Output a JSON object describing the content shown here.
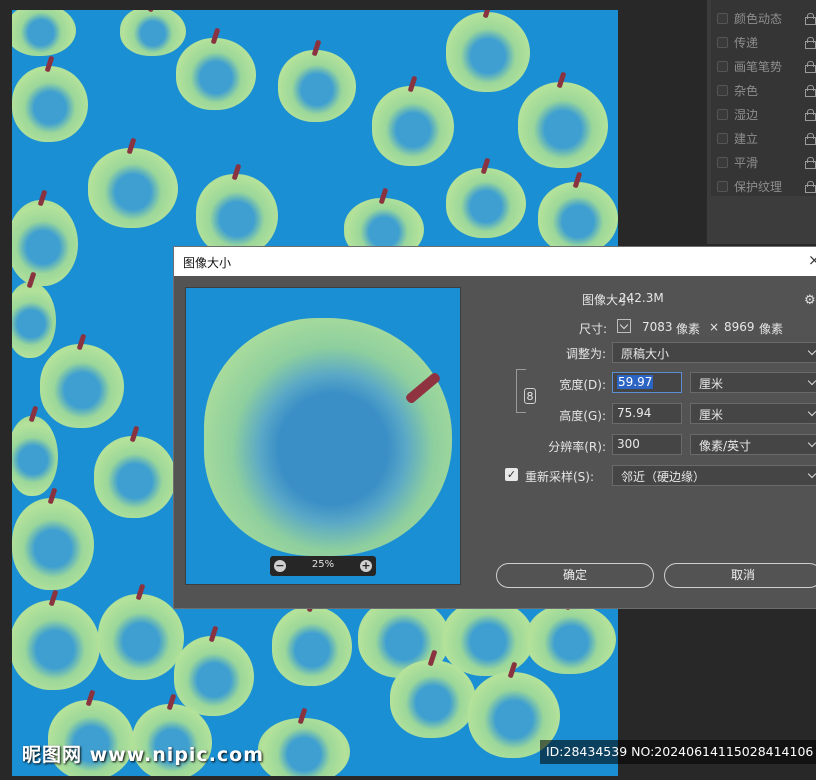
{
  "brush_panel": {
    "items": [
      {
        "label": "颜色动态"
      },
      {
        "label": "传递"
      },
      {
        "label": "画笔笔势"
      },
      {
        "label": "杂色"
      },
      {
        "label": "湿边"
      },
      {
        "label": "建立"
      },
      {
        "label": "平滑"
      },
      {
        "label": "保护纹理"
      }
    ]
  },
  "dialog": {
    "title": "图像大小",
    "close_glyph": "×",
    "image_size_label": "图像大小:",
    "image_size_value": "242.3M",
    "dimensions_label": "尺寸:",
    "dim_width_px": "7083",
    "dim_unit1": "像素",
    "dim_times": "×",
    "dim_height_px": "8969",
    "dim_unit2": "像素",
    "fit_label": "调整为:",
    "fit_value": "原稿大小",
    "width_label": "宽度(D):",
    "width_value": "59.97",
    "width_unit": "厘米",
    "height_label": "高度(G):",
    "height_value": "75.94",
    "height_unit": "厘米",
    "resolution_label": "分辨率(R):",
    "resolution_value": "300",
    "resolution_unit": "像素/英寸",
    "resample_label": "重新采样(S):",
    "resample_checked": true,
    "resample_value": "邻近（硬边缘）",
    "zoom_level": "25%",
    "ok_label": "确定",
    "cancel_label": "取消",
    "gear_glyph": "⚙",
    "chain_glyph": "8"
  },
  "watermark": {
    "logo": "昵图网 www.nipic.com",
    "id_text": "ID:28434539 NO:20240614115028414106"
  },
  "colors": {
    "canvas_bg": "#1b8fd3",
    "apple_green": "#a9dc9c",
    "dialog_bg": "#535353"
  }
}
